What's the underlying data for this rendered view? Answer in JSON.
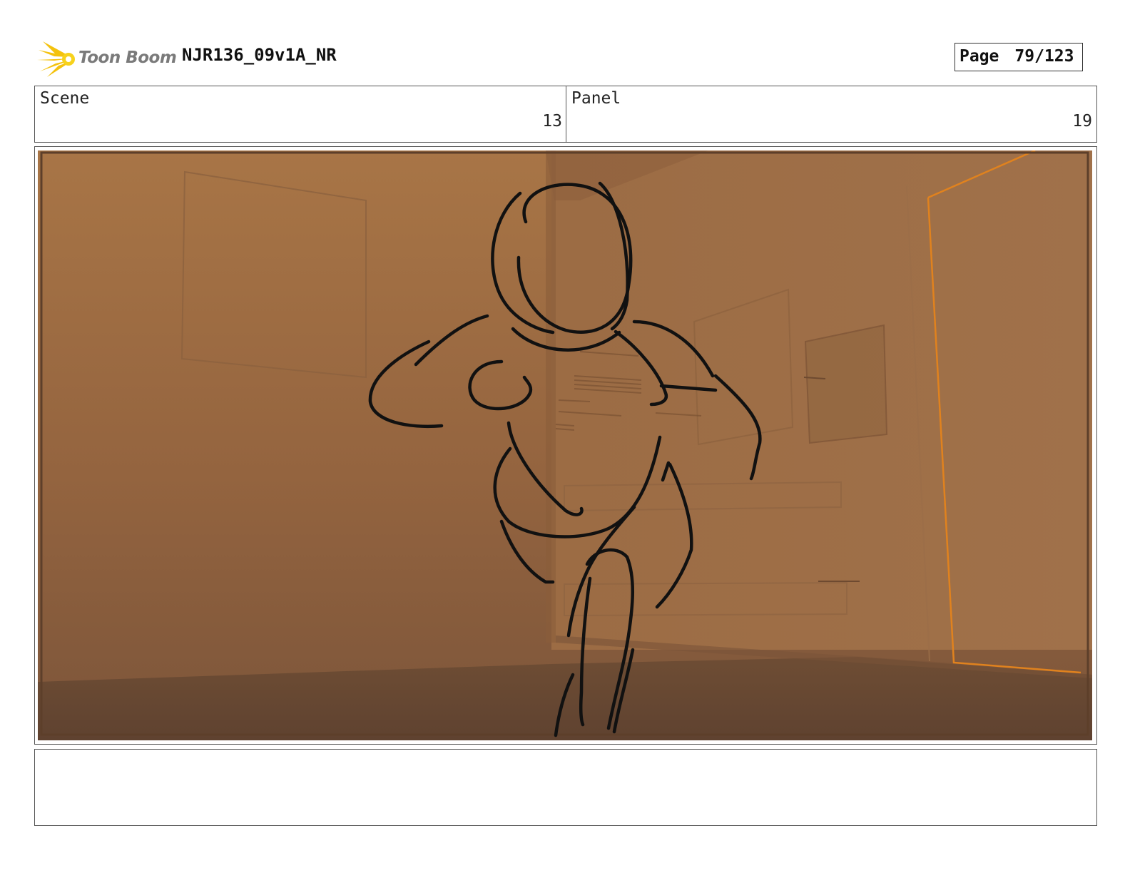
{
  "header": {
    "logo_text": "Toon Boom",
    "title": "NJR136_09v1A_NR",
    "page_label": "Page",
    "page_number": "79/123"
  },
  "info": {
    "scene_label": "Scene",
    "scene_value": "13",
    "panel_label": "Panel",
    "panel_value": "19"
  },
  "notes": {
    "text": ""
  },
  "colors": {
    "background_warm": "#a36f43",
    "floor": "#6b4a32",
    "sketch_stroke": "#111111",
    "accent_orange": "#e0821e"
  }
}
